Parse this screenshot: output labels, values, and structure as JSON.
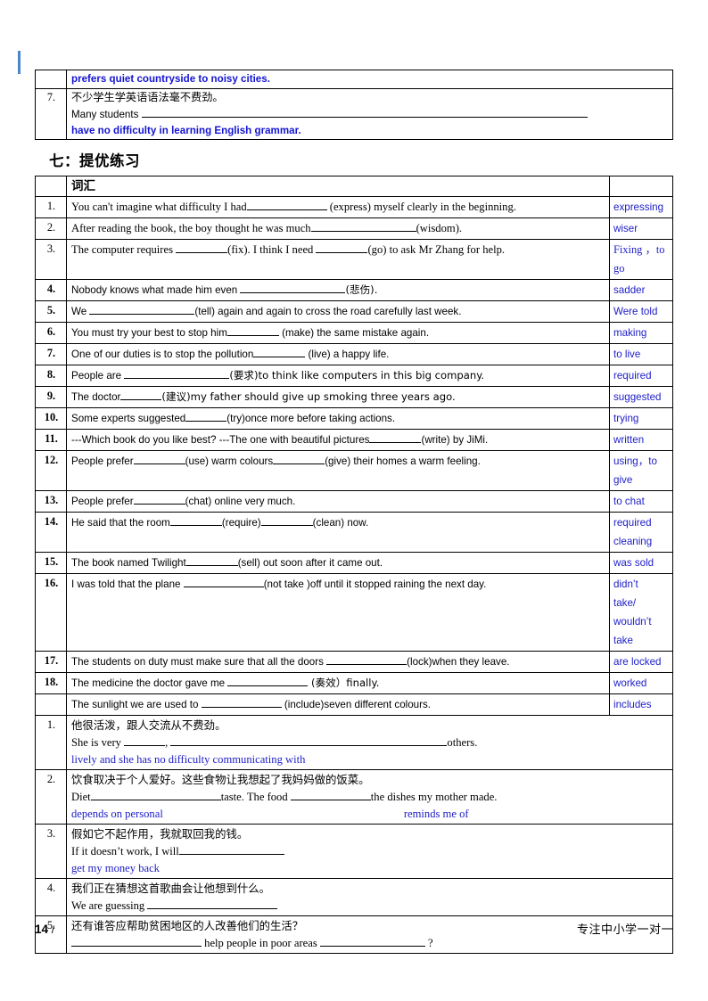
{
  "top_table": {
    "rows": [
      {
        "num": "",
        "blue_answer": "prefers quiet countryside to noisy cities."
      },
      {
        "num": "7.",
        "chinese": "不少学生学英语语法毫不费劲。",
        "english_prefix": "Many students",
        "blue_answer": "have no difficulty in learning English grammar."
      }
    ]
  },
  "section": {
    "heading": "七：提优练习"
  },
  "main_table": {
    "header": {
      "num": "",
      "title": "词汇",
      "answer": ""
    },
    "rows": [
      {
        "num": "1.",
        "q_pre": "You can't imagine what difficulty I had",
        "q_post": " (express) myself clearly in the beginning.",
        "answer": "expressing"
      },
      {
        "num": "2.",
        "q_pre": "After reading the book, the boy thought he was much",
        "q_post": "(wisdom).",
        "answer": "wiser"
      },
      {
        "num": "3.",
        "q_pre": "The computer requires ",
        "q_mid": "(fix). I think I need ",
        "q_post": "(go) to ask Mr Zhang for help.",
        "answer": "Fixing ，to go"
      },
      {
        "num": "4.",
        "q_pre": "Nobody knows what made him even ",
        "q_post": "(悲伤).",
        "answer": "sadder"
      },
      {
        "num": "5.",
        "q_pre": "We ",
        "q_post": "(tell) again and again to cross the road carefully last week.",
        "answer": "Were told"
      },
      {
        "num": "6.",
        "q_pre": "You must try your best to stop him",
        "q_post": " (make) the same mistake again.",
        "answer": "making"
      },
      {
        "num": "7.",
        "q_pre": "One of our duties is to stop the pollution",
        "q_post": " (live) a happy life.",
        "answer": "to live"
      },
      {
        "num": "8.",
        "q_pre": "People are  ",
        "q_post": "(要求)to think like computers in this big company.",
        "answer": "required"
      },
      {
        "num": "9.",
        "q_pre": "The doctor",
        "q_post": "(建议)my father should give up smoking three years ago.",
        "answer": "suggested"
      },
      {
        "num": "10.",
        "q_pre": "Some experts suggested",
        "q_post": "(try)once more before taking actions.",
        "answer": "trying"
      },
      {
        "num": "11.",
        "q_pre": "---Which book do you like best? ---The one with beautiful pictures",
        "q_post": "(write) by JiMi.",
        "answer": "written"
      },
      {
        "num": "12.",
        "q_pre": "People prefer",
        "q_mid": "(use) warm colours",
        "q_post": "(give) their homes a warm feeling.",
        "answer": "using，to give"
      },
      {
        "num": "13.",
        "q_pre": "People prefer",
        "q_post": "(chat) online very much.",
        "answer": "to chat"
      },
      {
        "num": "14.",
        "q_pre": "He said that the room",
        "q_mid": "(require)",
        "q_post": "(clean) now.",
        "answer": "required cleaning"
      },
      {
        "num": "15.",
        "q_pre": "The book named Twilight",
        "q_post": "(sell) out soon after it came out.",
        "answer": "was sold"
      },
      {
        "num": "16.",
        "q_pre": "I was told that the plane   ",
        "q_post": "(not take )off until it stopped raining the next day.",
        "answer": "didn’t take/ wouldn’t take"
      },
      {
        "num": "17.",
        "q_pre": "The students on duty must make sure that all the doors   ",
        "q_post": "(lock)when they leave.",
        "answer": "are locked"
      },
      {
        "num": "18.",
        "q_pre": "The medicine the doctor gave me ",
        "q_post": " (奏效）finally.",
        "answer": "worked"
      },
      {
        "num": "",
        "q_pre": "The sunlight we are used to ",
        "q_post": " (include)seven different colours.",
        "answer": "includes"
      }
    ],
    "translation_rows": [
      {
        "num": "1.",
        "chinese": "他很活泼，跟人交流从不费劲。",
        "en_pre": "She is very ",
        "en_mid": ", ",
        "en_post": "others.",
        "blue_answer": "lively and she has no difficulty communicating with",
        "blue_answer2": ""
      },
      {
        "num": "2.",
        "chinese": "饮食取决于个人爱好。这些食物让我想起了我妈妈做的饭菜。",
        "en_pre": "Diet",
        "en_mid": "taste. The food ",
        "en_post": "the dishes my mother made.",
        "blue_answer": "depends on personal",
        "blue_answer2": "reminds me of"
      },
      {
        "num": "3.",
        "chinese": "假如它不起作用，我就取回我的钱。",
        "en_pre": "If it doesn’t work, I will",
        "en_mid": "",
        "en_post": "",
        "blue_answer": "get my money back",
        "blue_answer2": ""
      },
      {
        "num": "4.",
        "chinese": "我们正在猜想这首歌曲会让他想到什么。",
        "en_pre": "We are guessing ",
        "en_mid": "",
        "en_post": "",
        "blue_answer": "",
        "blue_answer2": ""
      },
      {
        "num": "5.",
        "chinese": "还有谁答应帮助贫困地区的人改善他们的生活？",
        "en_pre": " ",
        "en_mid": " help people in poor areas ",
        "en_post": " ?",
        "blue_answer": "",
        "blue_answer2": ""
      }
    ]
  },
  "footer": {
    "page_number": "14",
    "page_slash": "/",
    "brand": "专注中小学一对一"
  },
  "colors": {
    "answer_blue": "#2020c8",
    "heading_blue_bold": "#1414d2",
    "change_bar": "#4a86c8",
    "border": "#000000"
  }
}
